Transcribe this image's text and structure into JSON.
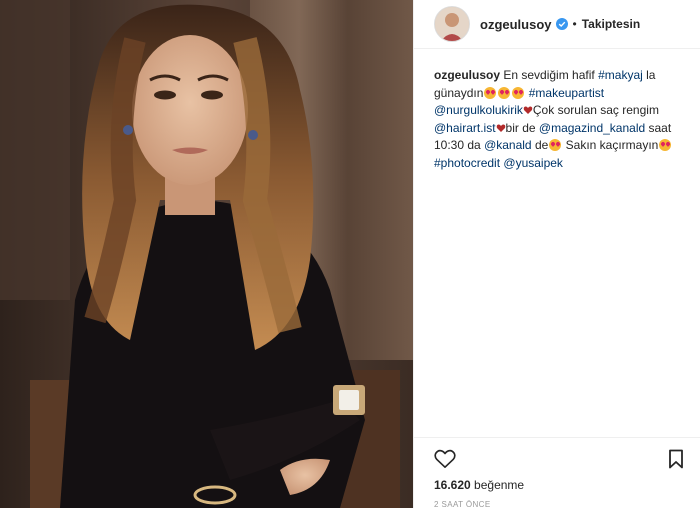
{
  "header": {
    "username": "ozgeulusoy",
    "separator": "•",
    "follow_status": "Takiptesin",
    "avatar_icon": "profile-avatar-icon",
    "verified_icon": "verified-badge-icon"
  },
  "caption": {
    "username": "ozgeulusoy",
    "t1": "En sevdiğim hafif",
    "makyaj_tag": "#makyaj",
    "t2": "la günaydın",
    "makeupartist_tag": "#makeupartist",
    "nurgul_mention": "@nurgulkolukirik",
    "t3": "Çok sorulan saç rengim",
    "hairartist_mention": "@hairart.ist",
    "t4": "bir de",
    "magazind_mention": "@magazind_kanald",
    "t5": "saat 10:30 da",
    "kanald_mention": "@kanald",
    "t6": "de",
    "t7": "Sakın kaçırmayın",
    "photocredit_tag": "#photocredit",
    "yusaipek_mention": "@yusaipek"
  },
  "actions": {
    "like_icon": "heart-outline-icon",
    "save_icon": "bookmark-icon",
    "likes_count": "16.620",
    "likes_label": "beğenme",
    "time_ago": "2 SAAT ÖNCE"
  },
  "colors": {
    "link": "#003569",
    "verified": "#3897f0",
    "text": "#262626"
  }
}
